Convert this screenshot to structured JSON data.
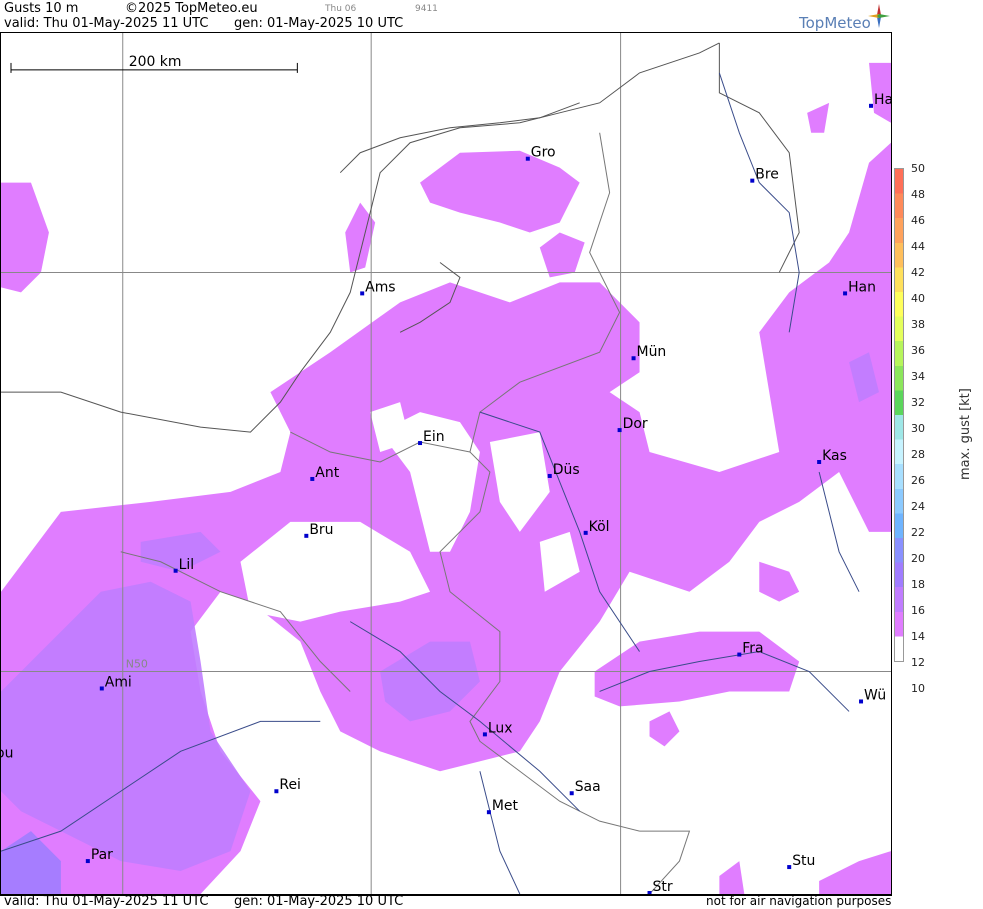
{
  "header": {
    "title": "Gusts 10 m",
    "copyright": "©2025 TopMeteo.eu",
    "valid": "valid:  Thu  01-May-2025  11 UTC",
    "gen": "gen: 01-May-2025 10 UTC",
    "small1": "Thu 06",
    "small2": "9411",
    "logo": "TopMeteo"
  },
  "footer": {
    "valid": "valid:  Thu  01-May-2025  11 UTC",
    "gen": "gen: 01-May-2025 10 UTC",
    "disclaimer": "not for air navigation purposes"
  },
  "scale": {
    "label": "200 km"
  },
  "grid_label": "N50",
  "cities": [
    {
      "name": "Gro"
    },
    {
      "name": "Bre"
    },
    {
      "name": "Ha"
    },
    {
      "name": "Ams"
    },
    {
      "name": "Han"
    },
    {
      "name": "Mün"
    },
    {
      "name": "Dor"
    },
    {
      "name": "Ein"
    },
    {
      "name": "Kas"
    },
    {
      "name": "Ant"
    },
    {
      "name": "Düs"
    },
    {
      "name": "Köl"
    },
    {
      "name": "Bru"
    },
    {
      "name": "Lil"
    },
    {
      "name": "Fra"
    },
    {
      "name": "Ami"
    },
    {
      "name": "Wü"
    },
    {
      "name": "ou"
    },
    {
      "name": "Lux"
    },
    {
      "name": "Rei"
    },
    {
      "name": "Saa"
    },
    {
      "name": "Met"
    },
    {
      "name": "Stu"
    },
    {
      "name": "Par"
    },
    {
      "name": "Str"
    }
  ],
  "legend": {
    "label": "max. gust [kt]",
    "ticks": [
      "50",
      "48",
      "46",
      "44",
      "42",
      "40",
      "38",
      "36",
      "34",
      "32",
      "30",
      "28",
      "26",
      "24",
      "22",
      "20",
      "18",
      "16",
      "14",
      "12",
      "10"
    ],
    "colors": [
      "#ff6f58",
      "#ff8a5a",
      "#ffa25c",
      "#ffbf5c",
      "#ffe05c",
      "#ffff5c",
      "#e5ff5c",
      "#b7f55c",
      "#8ce65c",
      "#5cd65c",
      "#9fe7e7",
      "#c7f3ff",
      "#a8dfff",
      "#8ccaff",
      "#6fb4ff",
      "#8a91ff",
      "#a07dff",
      "#c07dff",
      "#e07dff",
      "#ffffff"
    ]
  }
}
